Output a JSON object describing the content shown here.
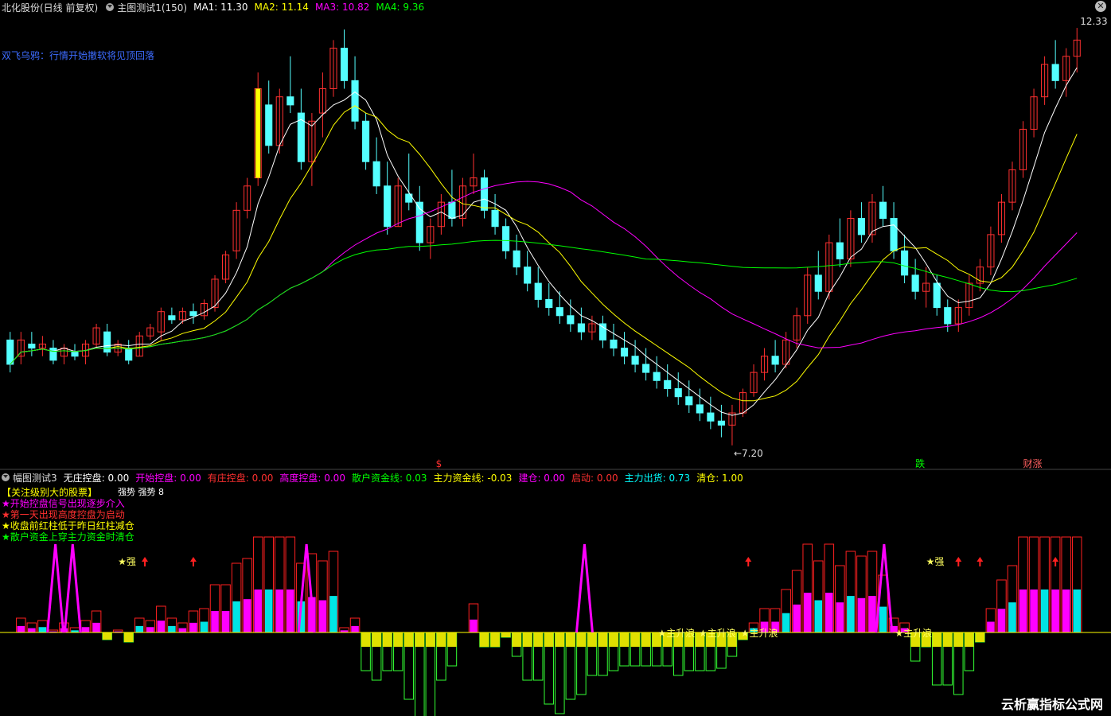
{
  "header": {
    "title": "北化股份(日线 前复权)",
    "indicator": "主图测试1(150)",
    "ma": [
      {
        "label": "MA1: 11.30",
        "color": "#ffffff"
      },
      {
        "label": "MA2: 11.14",
        "color": "#ffff00"
      },
      {
        "label": "MA3: 10.82",
        "color": "#ff00ff"
      },
      {
        "label": "MA4: 9.36",
        "color": "#00ff00"
      }
    ],
    "close_icon": "close-icon"
  },
  "main_note": "双飞乌鸦：行情开始撤软将见顶回落",
  "sub_header": {
    "indicator": "幅图测试3",
    "items": [
      {
        "label": "无庄控盘: 0.00",
        "color": "#ffffff"
      },
      {
        "label": "开始控盘: 0.00",
        "color": "#ff00ff"
      },
      {
        "label": "有庄控盘: 0.00",
        "color": "#ff3030"
      },
      {
        "label": "高度控盘: 0.00",
        "color": "#ff00ff"
      },
      {
        "label": "散户资金线: 0.03",
        "color": "#00ff00"
      },
      {
        "label": "主力资金线: -0.03",
        "color": "#ffff00"
      },
      {
        "label": "建仓: 0.00",
        "color": "#ff00ff"
      },
      {
        "label": "启动: 0.00",
        "color": "#ff3030"
      },
      {
        "label": "主力出货: 0.73",
        "color": "#00ffff"
      },
      {
        "label": "清仓: 1.00",
        "color": "#ffff00"
      }
    ]
  },
  "legend": [
    {
      "text": "【关注级别大的股票】",
      "color": "#ffff00"
    },
    {
      "text": "★开始控盘信号出现逐步介入",
      "color": "#ff00ff"
    },
    {
      "text": "★第一天出现高度控盘为启动",
      "color": "#ff3030"
    },
    {
      "text": "★收盘前红柱低于昨日红柱减仓",
      "color": "#ffff00"
    },
    {
      "text": "★散户资金上穿主力资金时清仓",
      "color": "#00ff00"
    }
  ],
  "legend_extra": {
    "a": "强势",
    "b": "强势",
    "c": "8"
  },
  "watermark": "云析赢指标公式网",
  "chart_data": {
    "type": "candlestick",
    "high_label": "12.33",
    "low_label": "←7.20",
    "event_labels": [
      {
        "text": "$",
        "color": "#ff3030"
      },
      {
        "text": "跌",
        "color": "#00ff00"
      },
      {
        "text": "财涨",
        "color": "#ff6060"
      }
    ],
    "sub_labels": {
      "strong": "★强",
      "main": "★主升浪"
    },
    "ohlc": [
      [
        8.5,
        8.6,
        8.1,
        8.2
      ],
      [
        8.3,
        8.6,
        8.2,
        8.5
      ],
      [
        8.45,
        8.6,
        8.3,
        8.4
      ],
      [
        8.4,
        8.55,
        8.3,
        8.45
      ],
      [
        8.4,
        8.5,
        8.2,
        8.25
      ],
      [
        8.3,
        8.45,
        8.2,
        8.4
      ],
      [
        8.35,
        8.45,
        8.25,
        8.3
      ],
      [
        8.3,
        8.5,
        8.2,
        8.45
      ],
      [
        8.45,
        8.7,
        8.4,
        8.65
      ],
      [
        8.6,
        8.7,
        8.3,
        8.35
      ],
      [
        8.35,
        8.5,
        8.3,
        8.45
      ],
      [
        8.4,
        8.5,
        8.2,
        8.25
      ],
      [
        8.3,
        8.6,
        8.3,
        8.55
      ],
      [
        8.55,
        8.7,
        8.5,
        8.65
      ],
      [
        8.6,
        8.9,
        8.5,
        8.85
      ],
      [
        8.8,
        8.9,
        8.7,
        8.75
      ],
      [
        8.75,
        8.9,
        8.7,
        8.85
      ],
      [
        8.85,
        8.95,
        8.7,
        8.8
      ],
      [
        8.8,
        9.0,
        8.75,
        8.95
      ],
      [
        8.9,
        9.3,
        8.85,
        9.25
      ],
      [
        9.25,
        9.6,
        9.2,
        9.55
      ],
      [
        9.6,
        10.2,
        9.5,
        10.1
      ],
      [
        10.1,
        10.5,
        10.0,
        10.4
      ],
      [
        10.5,
        11.8,
        10.4,
        11.6
      ],
      [
        11.4,
        11.7,
        10.8,
        10.9
      ],
      [
        10.9,
        11.6,
        10.8,
        11.5
      ],
      [
        11.5,
        12.0,
        11.3,
        11.4
      ],
      [
        11.3,
        11.6,
        10.6,
        10.7
      ],
      [
        10.7,
        11.3,
        10.4,
        11.2
      ],
      [
        11.3,
        11.8,
        11.0,
        11.6
      ],
      [
        11.6,
        12.2,
        11.5,
        12.1
      ],
      [
        12.1,
        12.33,
        11.6,
        11.7
      ],
      [
        11.7,
        12.0,
        11.1,
        11.2
      ],
      [
        11.2,
        11.3,
        10.6,
        10.7
      ],
      [
        10.7,
        11.0,
        10.3,
        10.4
      ],
      [
        10.4,
        10.7,
        9.8,
        9.9
      ],
      [
        9.9,
        10.5,
        9.9,
        10.4
      ],
      [
        10.3,
        10.8,
        10.1,
        10.2
      ],
      [
        10.2,
        10.4,
        9.6,
        9.7
      ],
      [
        9.7,
        10.0,
        9.5,
        9.9
      ],
      [
        9.9,
        10.3,
        9.8,
        10.2
      ],
      [
        10.2,
        10.6,
        9.9,
        10.0
      ],
      [
        10.0,
        10.5,
        9.9,
        10.4
      ],
      [
        10.4,
        10.8,
        10.3,
        10.5
      ],
      [
        10.5,
        10.6,
        10.0,
        10.1
      ],
      [
        10.1,
        10.3,
        9.8,
        9.9
      ],
      [
        9.9,
        10.0,
        9.5,
        9.6
      ],
      [
        9.6,
        9.8,
        9.3,
        9.4
      ],
      [
        9.4,
        9.6,
        9.1,
        9.2
      ],
      [
        9.2,
        9.4,
        8.9,
        9.0
      ],
      [
        9.0,
        9.2,
        8.8,
        8.9
      ],
      [
        8.9,
        9.1,
        8.7,
        8.8
      ],
      [
        8.8,
        9.0,
        8.6,
        8.7
      ],
      [
        8.7,
        8.9,
        8.5,
        8.6
      ],
      [
        8.6,
        8.8,
        8.5,
        8.7
      ],
      [
        8.7,
        8.8,
        8.4,
        8.5
      ],
      [
        8.5,
        8.7,
        8.3,
        8.4
      ],
      [
        8.4,
        8.6,
        8.2,
        8.3
      ],
      [
        8.3,
        8.5,
        8.1,
        8.2
      ],
      [
        8.2,
        8.4,
        8.0,
        8.1
      ],
      [
        8.1,
        8.3,
        7.9,
        8.0
      ],
      [
        8.0,
        8.2,
        7.8,
        7.9
      ],
      [
        7.9,
        8.1,
        7.7,
        7.8
      ],
      [
        7.8,
        8.0,
        7.6,
        7.7
      ],
      [
        7.7,
        7.9,
        7.5,
        7.6
      ],
      [
        7.6,
        7.8,
        7.4,
        7.5
      ],
      [
        7.5,
        7.7,
        7.3,
        7.45
      ],
      [
        7.45,
        7.7,
        7.2,
        7.6
      ],
      [
        7.6,
        7.9,
        7.55,
        7.85
      ],
      [
        7.85,
        8.2,
        7.8,
        8.1
      ],
      [
        8.1,
        8.4,
        8.0,
        8.3
      ],
      [
        8.3,
        8.5,
        8.1,
        8.2
      ],
      [
        8.2,
        8.6,
        8.15,
        8.5
      ],
      [
        8.5,
        8.9,
        8.4,
        8.8
      ],
      [
        8.8,
        9.4,
        8.7,
        9.3
      ],
      [
        9.3,
        9.6,
        9.0,
        9.1
      ],
      [
        9.1,
        9.8,
        9.0,
        9.7
      ],
      [
        9.7,
        10.0,
        9.4,
        9.5
      ],
      [
        9.5,
        10.1,
        9.4,
        10.0
      ],
      [
        10.0,
        10.2,
        9.7,
        9.8
      ],
      [
        9.8,
        10.3,
        9.7,
        10.2
      ],
      [
        10.2,
        10.4,
        9.9,
        10.0
      ],
      [
        10.0,
        10.2,
        9.5,
        9.6
      ],
      [
        9.6,
        9.8,
        9.2,
        9.3
      ],
      [
        9.3,
        9.5,
        9.0,
        9.1
      ],
      [
        9.1,
        9.4,
        8.9,
        9.2
      ],
      [
        9.2,
        9.3,
        8.8,
        8.9
      ],
      [
        8.9,
        9.0,
        8.6,
        8.7
      ],
      [
        8.7,
        9.0,
        8.6,
        8.9
      ],
      [
        8.9,
        9.3,
        8.8,
        9.2
      ],
      [
        9.2,
        9.5,
        9.1,
        9.4
      ],
      [
        9.4,
        9.9,
        9.3,
        9.8
      ],
      [
        9.8,
        10.3,
        9.7,
        10.2
      ],
      [
        10.2,
        10.7,
        10.1,
        10.6
      ],
      [
        10.6,
        11.2,
        10.5,
        11.1
      ],
      [
        11.1,
        11.6,
        11.0,
        11.5
      ],
      [
        11.5,
        12.0,
        11.4,
        11.9
      ],
      [
        11.9,
        12.2,
        11.6,
        11.7
      ],
      [
        11.7,
        12.1,
        11.5,
        12.0
      ],
      [
        12.0,
        12.35,
        11.8,
        12.2
      ]
    ]
  }
}
